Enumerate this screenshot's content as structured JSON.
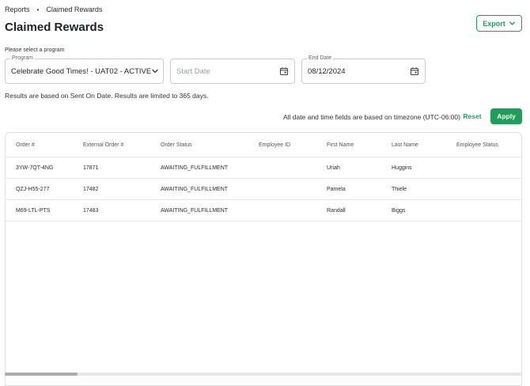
{
  "breadcrumb": {
    "items": [
      "Reports",
      "Claimed Rewards"
    ],
    "separator": "•"
  },
  "page": {
    "title": "Claimed Rewards"
  },
  "toolbar": {
    "export_label": "Export"
  },
  "filters": {
    "helper_text": "Please select a program",
    "program": {
      "label": "Program",
      "value": "Celebrate Good Times! - UAT02 - ACTIVE"
    },
    "start_date": {
      "placeholder": "Start Date"
    },
    "end_date": {
      "label": "End Date",
      "value": "08/12/2024"
    },
    "note": "Results are based on Sent On Date. Results are limited to 365 days.",
    "timezone_text": "All date and time fields are based on timezone (UTC-06:00)",
    "reset_label": "Reset",
    "apply_label": "Apply"
  },
  "table": {
    "columns": [
      "Order #",
      "External Order #",
      "Order Status",
      "Employee ID",
      "First Name",
      "Last Name",
      "Employee Status"
    ],
    "rows": [
      [
        "3YW-7QT-4NG",
        "17871",
        "AWAITING_FULFILLMENT",
        "",
        "Uriah",
        "Huggins",
        ""
      ],
      [
        "QZJ-H55-277",
        "17482",
        "AWAITING_FULFILLMENT",
        "",
        "Pamela",
        "Thiele",
        ""
      ],
      [
        "M69-LTL-PTS",
        "17483",
        "AWAITING_FULFILLMENT",
        "",
        "Randall",
        "Biggs",
        ""
      ]
    ]
  },
  "colors": {
    "accent": "#1f9d5a"
  },
  "icons": {
    "export": "chevron-down-icon",
    "program": "chevron-down-icon",
    "date": "calendar-icon"
  }
}
